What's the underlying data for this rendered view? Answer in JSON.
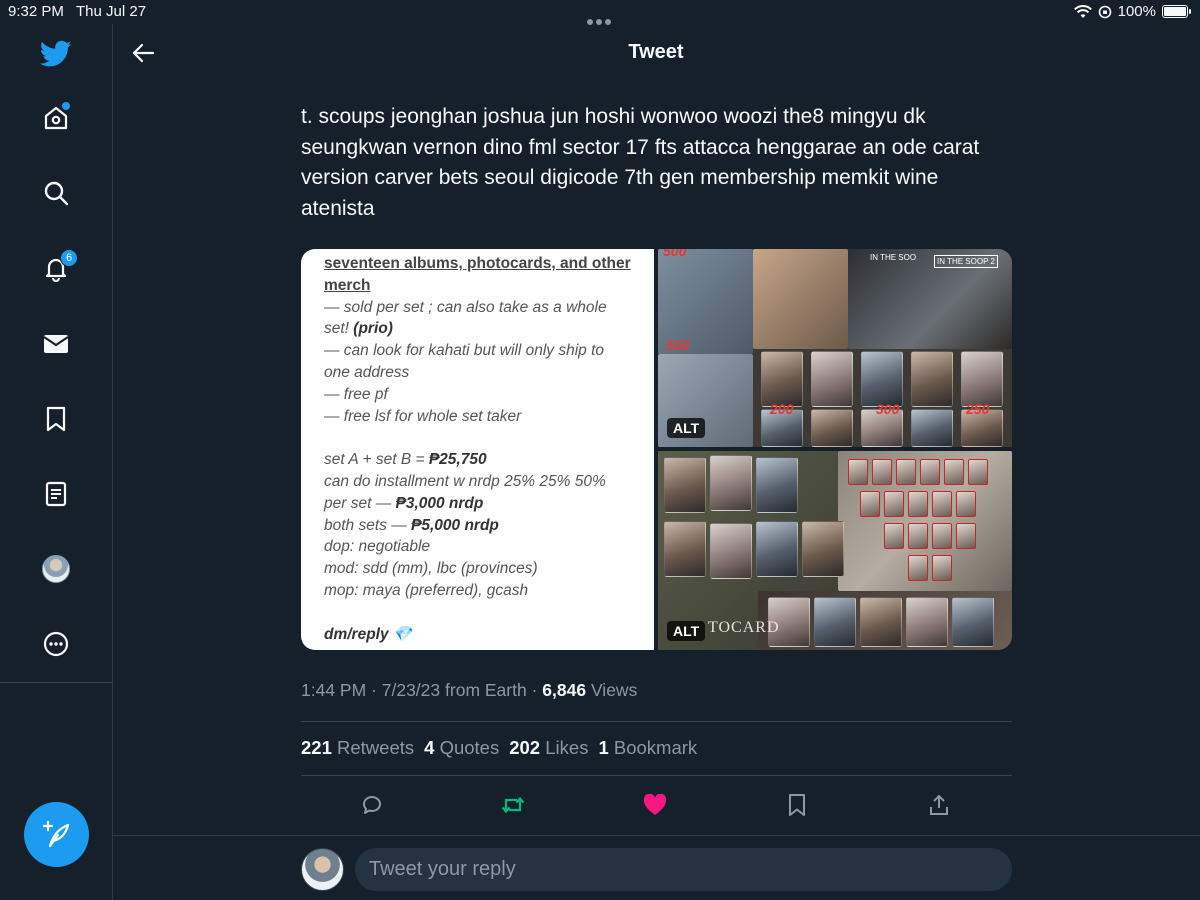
{
  "status_bar": {
    "time": "9:32 PM",
    "date": "Thu Jul 27",
    "battery": "100%",
    "battery_level": 1.0
  },
  "sidebar": {
    "items": [
      {
        "name": "home",
        "icon": "home-icon"
      },
      {
        "name": "explore",
        "icon": "search-icon"
      },
      {
        "name": "notifications",
        "icon": "bell-icon",
        "badge": "6"
      },
      {
        "name": "messages",
        "icon": "mail-icon"
      },
      {
        "name": "bookmarks",
        "icon": "bookmark-icon"
      },
      {
        "name": "lists",
        "icon": "list-icon"
      },
      {
        "name": "profile",
        "icon": "avatar"
      },
      {
        "name": "more",
        "icon": "more-icon"
      }
    ],
    "compose_icon": "compose-tweet-icon"
  },
  "header": {
    "title": "Tweet"
  },
  "tweet": {
    "text": "t. scoups jeonghan joshua jun hoshi wonwoo woozi the8 mingyu dk seungkwan vernon dino fml sector 17 fts attacca henggarae an ode carat version carver bets seoul digicode 7th gen membership memkit wine atenista",
    "media_left": {
      "title_line1": "seventeen albums, photocards, and other",
      "title_line2": "merch",
      "l1": "— sold per set ; can also take as a whole",
      "l2a": "set! ",
      "l2b": "(prio)",
      "l3": "— can look for kahati but will only ship to",
      "l4": "one address",
      "l5": "— free pf",
      "l6": "— free lsf for whole set taker",
      "l7a": "set A + set B = ",
      "l7b": "₱25,750",
      "l8": "can do installment w nrdp 25% 25% 50%",
      "l9a": "per set — ",
      "l9b": "₱3,000 nrdp",
      "l10a": "both sets — ",
      "l10b": "₱5,000 nrdp",
      "l11": "dop: negotiable",
      "l12": "mod: sdd (mm), lbc (provinces)",
      "l13": "mop: maya (preferred), gcash",
      "l14": "dm/reply 💎"
    },
    "alt_label": "ALT",
    "collage_text": {
      "p500a": "500",
      "p500b": "500",
      "p200": "200",
      "p300": "300",
      "p250": "250",
      "soop1": "IN THE SOO",
      "soop2": "IN THE SOOP 2",
      "photocard": "TOCARD"
    },
    "time": "1:44 PM",
    "date": "7/23/23",
    "source": "from Earth",
    "views_count": "6,846",
    "views_label": "Views",
    "stats": [
      {
        "count": "221",
        "label": "Retweets"
      },
      {
        "count": "4",
        "label": "Quotes"
      },
      {
        "count": "202",
        "label": "Likes"
      },
      {
        "count": "1",
        "label": "Bookmark"
      }
    ]
  },
  "actions": [
    {
      "name": "reply",
      "icon": "reply-icon"
    },
    {
      "name": "retweet",
      "icon": "retweet-icon",
      "color": "#00ba7c"
    },
    {
      "name": "like",
      "icon": "heart-icon",
      "color": "#f91880"
    },
    {
      "name": "bookmark",
      "icon": "bookmark-icon"
    },
    {
      "name": "share",
      "icon": "share-icon"
    }
  ],
  "reply": {
    "placeholder": "Tweet your reply"
  },
  "colors": {
    "background": "#15202b",
    "accent": "#1d9bf0",
    "muted": "#8b98a5",
    "like": "#f91880",
    "retweet": "#00ba7c"
  }
}
